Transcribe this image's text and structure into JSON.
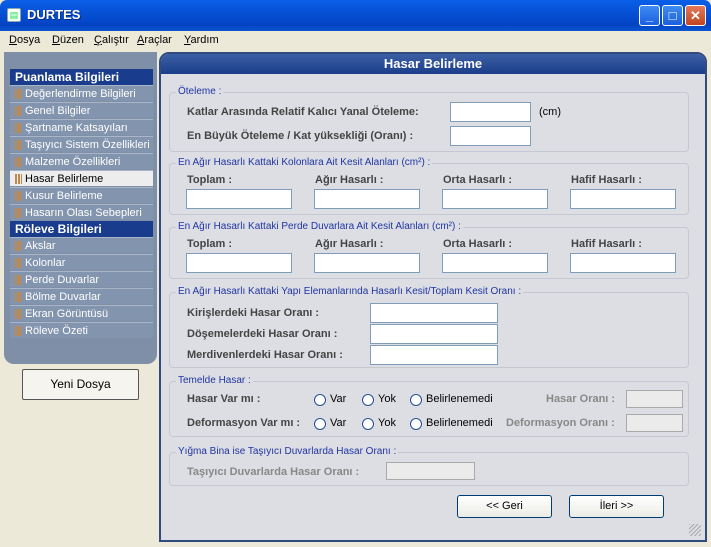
{
  "window": {
    "title": "DURTES",
    "icon": "app-icon"
  },
  "menu": [
    {
      "label": "Dosya",
      "key": "D",
      "rest": "osya"
    },
    {
      "label": "Düzen",
      "key": "D",
      "rest": "üzen"
    },
    {
      "label": "Çalıştır",
      "key": "Ç",
      "rest": "alıştır"
    },
    {
      "label": "Araçlar",
      "key": "A",
      "rest": "raçlar"
    },
    {
      "label": "Yardım",
      "key": "Y",
      "rest": "ardım"
    }
  ],
  "sidebar": {
    "section1": "Puanlama Bilgileri",
    "items1": [
      "Değerlendirme Bilgileri",
      "Genel Bilgiler",
      "Şartname Katsayıları",
      "Taşıyıcı Sistem Özellikleri",
      "Malzeme Özellikleri",
      "Hasar Belirleme",
      "Kusur Belirleme",
      "Hasarın Olası Sebepleri"
    ],
    "section2": "Röleve Bilgileri",
    "items2": [
      "Akslar",
      "Kolonlar",
      "Perde Duvarlar",
      "Bölme Duvarlar",
      "Ekran Görüntüsü",
      "Röleve Özeti"
    ],
    "active": "Hasar Belirleme",
    "new_file_button": "Yeni Dosya"
  },
  "main": {
    "title": "Hasar Belirleme",
    "oteleme": {
      "group": "Öteleme :",
      "relative_label": "Katlar Arasında Relatif Kalıcı Yanal Öteleme:",
      "relative_value": "",
      "unit": "(cm)",
      "max_label": "En Büyük Öteleme / Kat yüksekliği (Oranı) :",
      "max_value": ""
    },
    "kolon": {
      "group": "En Ağır Hasarlı Kattaki Kolonlara Ait Kesit Alanları (cm²) :",
      "cols": [
        "Toplam :",
        "Ağır Hasarlı :",
        "Orta Hasarlı :",
        "Hafif Hasarlı :"
      ]
    },
    "perde": {
      "group": "En Ağır Hasarlı Kattaki Perde Duvarlara Ait Kesit Alanları (cm²) :",
      "cols": [
        "Toplam :",
        "Ağır Hasarlı :",
        "Orta Hasarlı :",
        "Hafif Hasarlı :"
      ]
    },
    "eleman": {
      "group": "En Ağır Hasarlı Kattaki Yapı Elemanlarında Hasarlı Kesit/Toplam Kesit Oranı :",
      "kiris": "Kirişlerdeki Hasar Oranı :",
      "doseme": "Döşemelerdeki Hasar Oranı :",
      "merdiven": "Merdivenlerdeki Hasar Oranı :"
    },
    "temel": {
      "group": "Temelde Hasar :",
      "hasar_label": "Hasar Var mı :",
      "deform_label": "Deformasyon Var mı :",
      "options": [
        "Var",
        "Yok",
        "Belirlenemedi"
      ],
      "hasar_orani": "Hasar Oranı :",
      "deform_orani": "Deformasyon Oranı :"
    },
    "yigma": {
      "group": "Yığma Bina ise Taşıyıcı Duvarlarda Hasar Oranı :",
      "label": "Taşıyıcı Duvarlarda Hasar Oranı :"
    },
    "back_button": "<< Geri",
    "next_button": "İleri >>"
  }
}
